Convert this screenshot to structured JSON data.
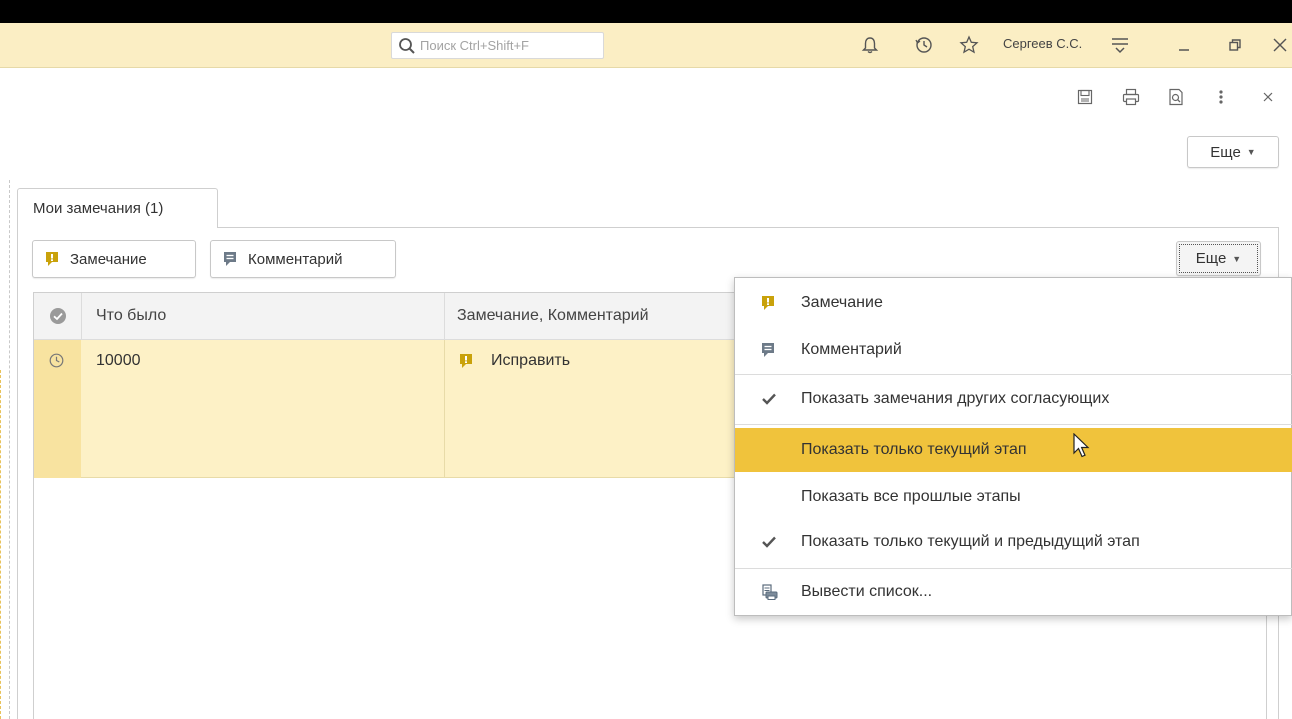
{
  "titlebar": {
    "search_placeholder": "Поиск Ctrl+Shift+F",
    "user_name": "Сергеев С.С."
  },
  "form": {
    "more_label": "Еще"
  },
  "tab": {
    "label": "Мои замечания (1)"
  },
  "commands": {
    "remark_label": "Замечание",
    "comment_label": "Комментарий",
    "more_label": "Еще"
  },
  "grid": {
    "columns": [
      "Что было",
      "Замечание, Комментарий"
    ],
    "rows": [
      {
        "was": "10000",
        "remark": "Исправить"
      }
    ]
  },
  "menu": {
    "items": [
      {
        "label": "Замечание",
        "icon": "remark-icon",
        "checked": false,
        "highlighted": false
      },
      {
        "label": "Комментарий",
        "icon": "comment-icon",
        "checked": false,
        "highlighted": false
      },
      {
        "label": "Показать замечания других согласующих",
        "icon": "check-icon",
        "checked": true,
        "highlighted": false
      },
      {
        "label": "Показать только текущий этап",
        "icon": "",
        "checked": false,
        "highlighted": true
      },
      {
        "label": "Показать все прошлые этапы",
        "icon": "",
        "checked": false,
        "highlighted": false
      },
      {
        "label": "Показать только текущий и предыдущий этап",
        "icon": "check-icon",
        "checked": true,
        "highlighted": false
      },
      {
        "label": "Вывести список...",
        "icon": "print-list-icon",
        "checked": false,
        "highlighted": false
      }
    ]
  },
  "colors": {
    "titlebar_bg": "#fbeec4",
    "highlight": "#f0c33c",
    "row_selected": "#fdf1c6",
    "remark_icon": "#c9a20b"
  }
}
